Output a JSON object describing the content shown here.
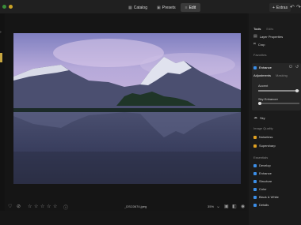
{
  "toolbar": {
    "catalog_label": "Catalog",
    "presets_label": "Presets",
    "edit_label": "Edit",
    "extras_label": "Extras"
  },
  "panel": {
    "tab_tools": "Tools",
    "tab_edits": "Edits",
    "layer_properties": "Layer Properties",
    "crop": "Crop",
    "favorites_header": "Favorites",
    "enhance_title": "Enhance",
    "tab_adjustments": "Adjustments",
    "tab_masking": "Masking",
    "accent": "Accent",
    "accent_value": 0.95,
    "sky_enhancer": "Sky Enhancer",
    "sky_enhancer_value": 0.04,
    "sky": "Sky",
    "image_quality_header": "Image Quality",
    "noiseless": "Noiseless",
    "supersharp": "Supersharp",
    "essentials_header": "Essentials",
    "develop": "Develop",
    "enhance": "Enhance",
    "structure": "Structure",
    "color": "Color",
    "black_white": "Black & White",
    "details": "Details"
  },
  "bottom": {
    "file_name": "_DSC0674.jpeg",
    "zoom": "35%",
    "rating_stars": [
      "☆",
      "☆",
      "☆",
      "☆",
      "☆"
    ]
  },
  "colors": {
    "accent_blue": "#3b8ee8",
    "accent_green": "#46c24a",
    "accent_orange": "#e0a020"
  }
}
